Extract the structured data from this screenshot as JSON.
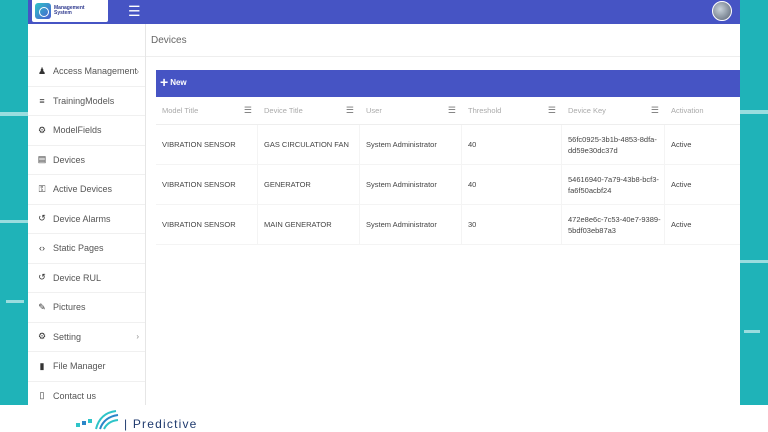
{
  "app": {
    "logo_text_line1": "",
    "logo_text_line2": "Management",
    "logo_text_line3": "System",
    "menu_icon": "hamburger-icon",
    "avatar_icon": "user-avatar"
  },
  "sidebar": {
    "items": [
      {
        "label": "Access Management",
        "icon": "user-icon",
        "glyph": "♟",
        "has_submenu": true
      },
      {
        "label": "TrainingModels",
        "icon": "database-icon",
        "glyph": "≡",
        "has_submenu": false
      },
      {
        "label": "ModelFields",
        "icon": "gear-icon",
        "glyph": "⚙",
        "has_submenu": false
      },
      {
        "label": "Devices",
        "icon": "device-icon",
        "glyph": "▤",
        "has_submenu": false
      },
      {
        "label": "Active Devices",
        "icon": "active-device-icon",
        "glyph": "⚿",
        "has_submenu": false
      },
      {
        "label": "Device Alarms",
        "icon": "alarm-icon",
        "glyph": "↺",
        "has_submenu": false
      },
      {
        "label": "Static Pages",
        "icon": "code-icon",
        "glyph": "‹›",
        "has_submenu": false
      },
      {
        "label": "Device RUL",
        "icon": "rul-icon",
        "glyph": "↺",
        "has_submenu": false
      },
      {
        "label": "Pictures",
        "icon": "pictures-icon",
        "glyph": "✎",
        "has_submenu": false
      },
      {
        "label": "Setting",
        "icon": "settings-icon",
        "glyph": "⚙",
        "has_submenu": true
      },
      {
        "label": "File Manager",
        "icon": "file-icon",
        "glyph": "▮",
        "has_submenu": false
      },
      {
        "label": "Contact us",
        "icon": "contact-icon",
        "glyph": "▯",
        "has_submenu": false
      }
    ],
    "chevron_glyph": "›"
  },
  "main": {
    "page_title": "Devices",
    "new_button_label": "New",
    "new_button_plus": "+",
    "filter_glyph": "☰",
    "columns": [
      "Model Title",
      "Device Title",
      "User",
      "Threshold",
      "Device Key",
      "Activation"
    ],
    "rows": [
      [
        "VIBRATION SENSOR",
        "GAS CIRCULATION FAN",
        "System Administrator",
        "40",
        "56fc0925-3b1b-4853-8dfa-dd59e30dc37d",
        "Active"
      ],
      [
        "VIBRATION SENSOR",
        "GENERATOR",
        "System Administrator",
        "40",
        "54616940-7a79-43b8-bcf3-fa6f50acbf24",
        "Active"
      ],
      [
        "VIBRATION SENSOR",
        "MAIN GENERATOR",
        "System Administrator",
        "30",
        "472e8e6c-7c53-40e7-9389-5bdf03eb87a3",
        "Active"
      ]
    ]
  },
  "brand": {
    "text": "| Predictive"
  },
  "colors": {
    "primary": "#4654c4",
    "background": "#1fb3b8"
  }
}
